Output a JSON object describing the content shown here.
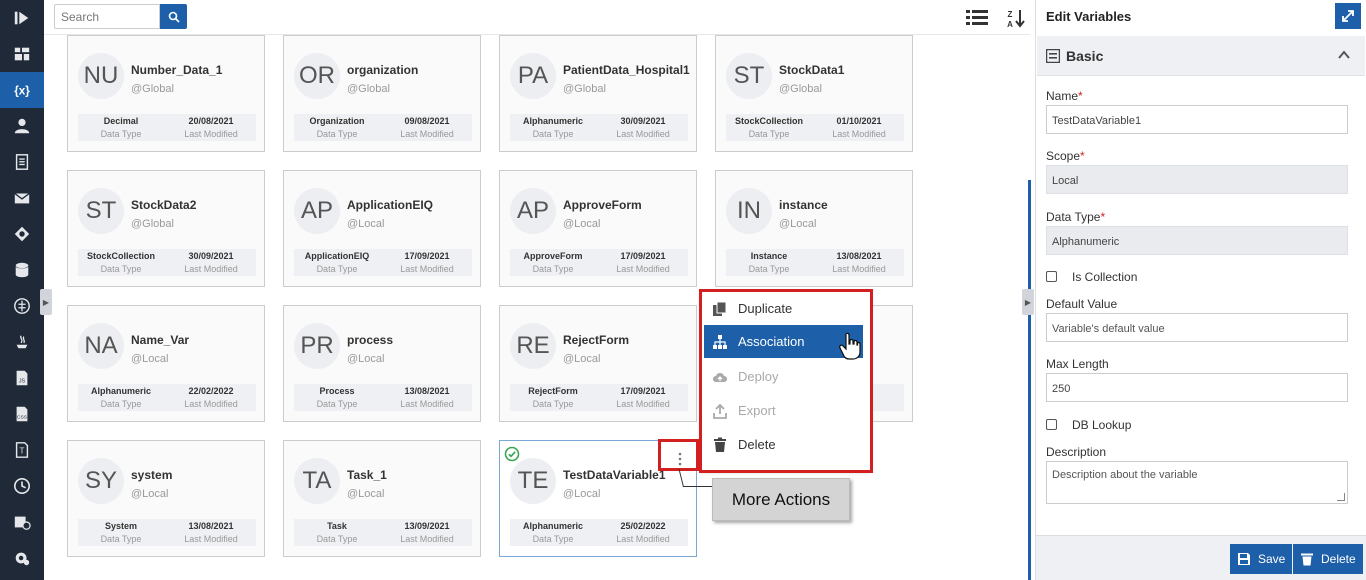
{
  "sidebar": {
    "icons": [
      "play-logo-icon",
      "dashboard-icon",
      "variables-icon",
      "user-icon",
      "document-icon",
      "mail-icon",
      "integration-icon",
      "database-icon",
      "network-icon",
      "java-icon",
      "json-icon",
      "css-icon",
      "template-icon",
      "history-icon",
      "report-icon",
      "settings-icon"
    ]
  },
  "toolbar": {
    "search_placeholder": "Search"
  },
  "cards": [
    {
      "initials": "NU",
      "name": "Number_Data_1",
      "scope": "@Global",
      "data_type": "Decimal",
      "modified": "20/08/2021",
      "dt_label": "Data Type",
      "lm_label": "Last Modified"
    },
    {
      "initials": "OR",
      "name": "organization",
      "scope": "@Global",
      "data_type": "Organization",
      "modified": "09/08/2021",
      "dt_label": "Data Type",
      "lm_label": "Last Modified"
    },
    {
      "initials": "PA",
      "name": "PatientData_Hospital1",
      "scope": "@Global",
      "data_type": "Alphanumeric",
      "modified": "30/09/2021",
      "dt_label": "Data Type",
      "lm_label": "Last Modified"
    },
    {
      "initials": "ST",
      "name": "StockData1",
      "scope": "@Global",
      "data_type": "StockCollection",
      "modified": "01/10/2021",
      "dt_label": "Data Type",
      "lm_label": "Last Modified"
    },
    {
      "initials": "ST",
      "name": "StockData2",
      "scope": "@Global",
      "data_type": "StockCollection",
      "modified": "30/09/2021",
      "dt_label": "Data Type",
      "lm_label": "Last Modified"
    },
    {
      "initials": "AP",
      "name": "ApplicationEIQ",
      "scope": "@Local",
      "data_type": "ApplicationEIQ",
      "modified": "17/09/2021",
      "dt_label": "Data Type",
      "lm_label": "Last Modified"
    },
    {
      "initials": "AP",
      "name": "ApproveForm",
      "scope": "@Local",
      "data_type": "ApproveForm",
      "modified": "17/09/2021",
      "dt_label": "Data Type",
      "lm_label": "Last Modified"
    },
    {
      "initials": "IN",
      "name": "instance",
      "scope": "@Local",
      "data_type": "Instance",
      "modified": "13/08/2021",
      "dt_label": "Data Type",
      "lm_label": "Last Modified"
    },
    {
      "initials": "NA",
      "name": "Name_Var",
      "scope": "@Local",
      "data_type": "Alphanumeric",
      "modified": "22/02/2022",
      "dt_label": "Data Type",
      "lm_label": "Last Modified"
    },
    {
      "initials": "PR",
      "name": "process",
      "scope": "@Local",
      "data_type": "Process",
      "modified": "13/08/2021",
      "dt_label": "Data Type",
      "lm_label": "Last Modified"
    },
    {
      "initials": "RE",
      "name": "RejectForm",
      "scope": "@Local",
      "data_type": "RejectForm",
      "modified": "17/09/2021",
      "dt_label": "Data Type",
      "lm_label": "Last Modified"
    },
    {
      "initials": "",
      "name": "",
      "scope": "",
      "data_type": "",
      "modified": "21",
      "dt_label": "",
      "lm_label": "ed"
    },
    {
      "initials": "SY",
      "name": "system",
      "scope": "@Local",
      "data_type": "System",
      "modified": "13/08/2021",
      "dt_label": "Data Type",
      "lm_label": "Last Modified"
    },
    {
      "initials": "TA",
      "name": "Task_1",
      "scope": "@Local",
      "data_type": "Task",
      "modified": "13/09/2021",
      "dt_label": "Data Type",
      "lm_label": "Last Modified"
    },
    {
      "initials": "TE",
      "name": "TestDataVariable1",
      "scope": "@Local",
      "data_type": "Alphanumeric",
      "modified": "25/02/2022",
      "dt_label": "Data Type",
      "lm_label": "Last Modified"
    }
  ],
  "context_menu": {
    "items": [
      {
        "label": "Duplicate",
        "icon": "duplicate-icon"
      },
      {
        "label": "Association",
        "icon": "association-icon"
      },
      {
        "label": "Deploy",
        "icon": "cloud-upload-icon"
      },
      {
        "label": "Export",
        "icon": "export-icon"
      },
      {
        "label": "Delete",
        "icon": "trash-icon"
      }
    ]
  },
  "callout": {
    "label": "More Actions"
  },
  "panel": {
    "title": "Edit Variables",
    "section": "Basic",
    "name_label": "Name",
    "name_value": "TestDataVariable1",
    "scope_label": "Scope",
    "scope_value": "Local",
    "data_type_label": "Data Type",
    "data_type_value": "Alphanumeric",
    "is_collection_label": "Is Collection",
    "default_value_label": "Default Value",
    "default_value_placeholder": "Variable's default value",
    "max_length_label": "Max Length",
    "max_length_value": "250",
    "db_lookup_label": "DB Lookup",
    "description_label": "Description",
    "description_placeholder": "Description about the variable",
    "required_mark": "*",
    "save_label": "Save",
    "delete_label": "Delete"
  },
  "colors": {
    "accent": "#1d5fa8",
    "highlight": "#d21f1f",
    "sidebar": "#1f2937",
    "success": "#3aa757"
  }
}
